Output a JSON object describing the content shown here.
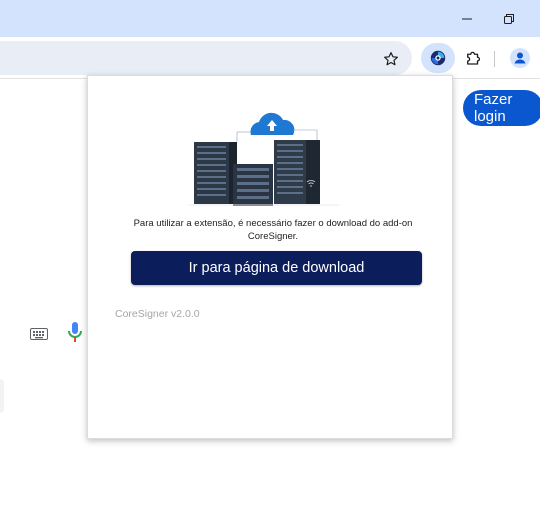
{
  "window": {
    "minimize_icon": "minimize-icon",
    "restore_icon": "restore-icon"
  },
  "toolbar": {
    "bookmark_icon": "star-icon",
    "extension_icon": "coresigner-icon",
    "extensions_icon": "puzzle-icon",
    "profile_icon": "person-icon"
  },
  "page": {
    "login_label": "Fazer login",
    "keyboard_icon": "keyboard-icon",
    "mic_icon": "mic-icon"
  },
  "popup": {
    "message": "Para utilizar a extensão, é necessário fazer o download do add-on CoreSigner.",
    "download_label": "Ir para página de download",
    "version": "CoreSigner v2.0.0",
    "brand_color": "#0c1d5c",
    "cloud_color": "#1f78d1"
  }
}
